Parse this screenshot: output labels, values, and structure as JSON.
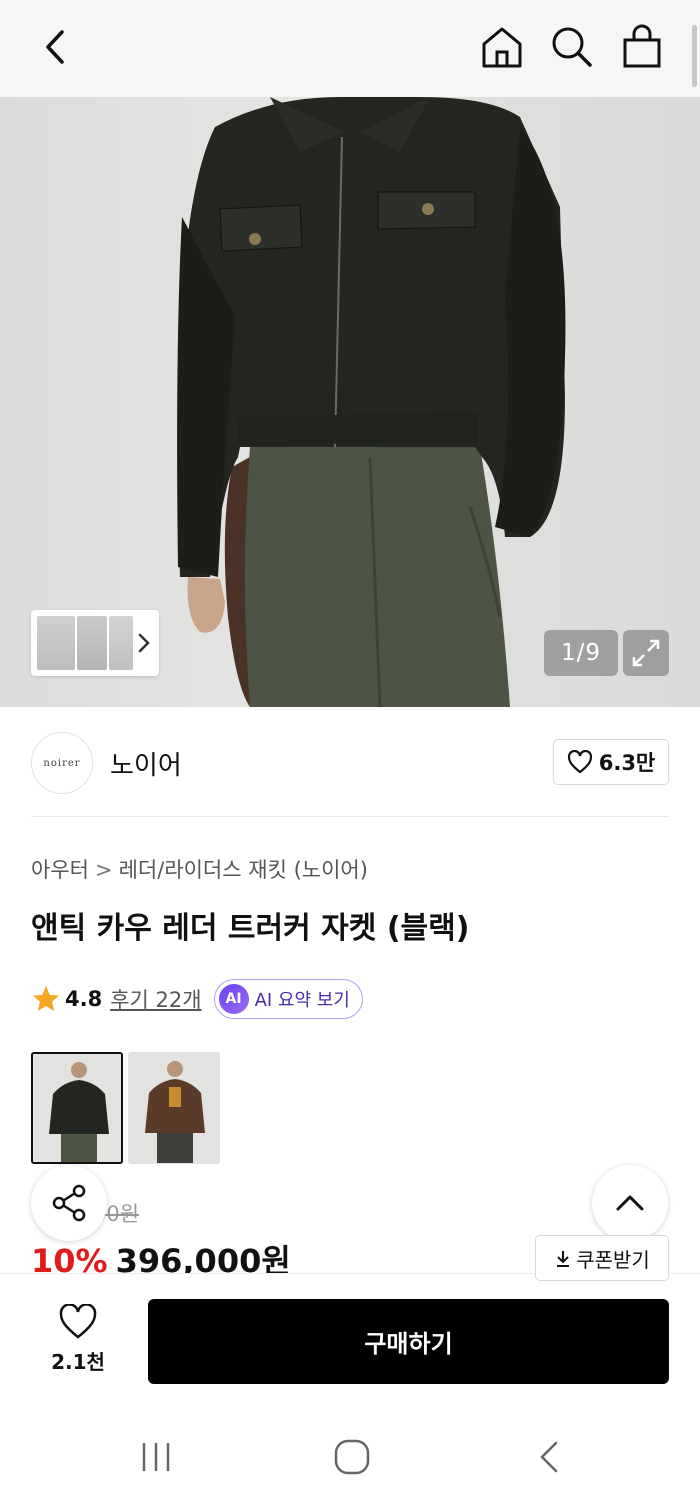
{
  "topbar": {
    "icons": [
      "back-arrow-icon",
      "home-icon",
      "search-icon",
      "shopping-bag-icon"
    ]
  },
  "hero": {
    "image_counter": "1/9",
    "expand_icon": "expand-icon",
    "thumb_chevron": "chevron-right-icon"
  },
  "brand": {
    "logo_text": "noirer",
    "name": "노이어",
    "likes": "6.3만"
  },
  "breadcrumb": {
    "category": "아우터",
    "separator": ">",
    "subcategory": "레더/라이더스 재킷 (노이어)"
  },
  "product": {
    "title": "앤틱 카우 레더 트러커 자켓 (블랙)",
    "rating": "4.8",
    "reviews": "후기 22개",
    "ai_badge": "AI",
    "ai_summary": "AI 요약 보기",
    "original_price_visible": "00원",
    "discount": "10%",
    "price": "396,000원",
    "coupon": "쿠폰받기"
  },
  "bottom": {
    "wish_count": "2.1천",
    "buy_label": "구매하기"
  },
  "colors": {
    "sale_red": "#e11a1a",
    "ai_purple": "#6b3ff0",
    "buy_black": "#000000",
    "star_orange": "#f5a623"
  }
}
